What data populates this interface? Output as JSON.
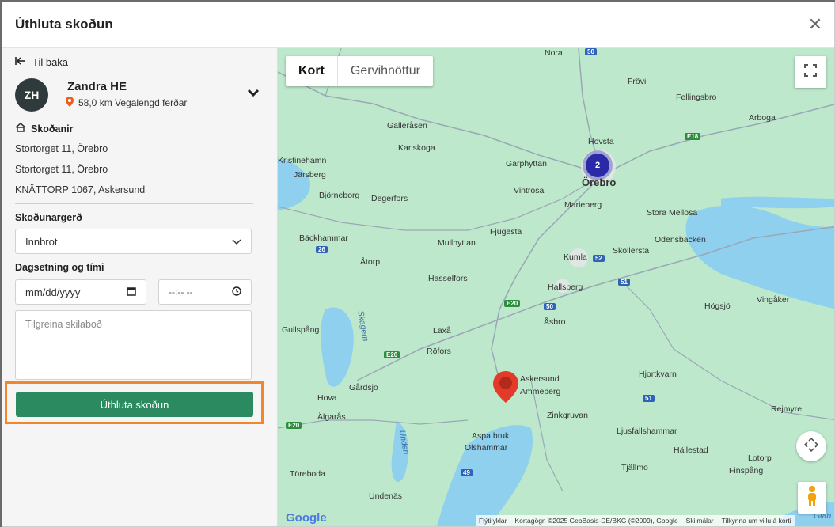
{
  "dialog": {
    "title": "Úthluta skoðun"
  },
  "left": {
    "back_label": "Til baka",
    "person": {
      "initials": "ZH",
      "name": "Zandra HE",
      "distance": "58,0 km Vegalengd ferðar"
    },
    "inspections_heading": "Skoðanir",
    "addresses": [
      "Stortorget 11, Örebro",
      "Stortorget 11, Örebro",
      "KNÄTTORP 1067, Askersund"
    ],
    "type_label": "Skoðunargerð",
    "type_value": "Innbrot",
    "datetime_label": "Dagsetning og tími",
    "date_placeholder": "mm/dd/yyyy",
    "time_placeholder": "--:-- --",
    "message_placeholder": "Tilgreina skilaboð",
    "submit_label": "Úthluta skoðun"
  },
  "map": {
    "tabs": {
      "map": "Kort",
      "satellite": "Gervihnöttur"
    },
    "cluster_count": "2",
    "towns": [
      "Nora",
      "Frövi",
      "Fellingsbro",
      "Arboga",
      "Gälleråsen",
      "Karlskoga",
      "Kristinehamn",
      "Järsberg",
      "Hovsta",
      "Garphyttan",
      "Örebro",
      "Vintrosa",
      "Marieberg",
      "Björneborg",
      "Degerfors",
      "Stora Mellösa",
      "Fjugesta",
      "Bäckhammar",
      "Mullhyttan",
      "Odensbacken",
      "Sköllersta",
      "Kumla",
      "Åtorp",
      "Hasselfors",
      "Hallsberg",
      "Högsjö",
      "Vingåker",
      "Gullspång",
      "Laxå",
      "Åsbro",
      "Röfors",
      "Hjortkvarn",
      "Askersund",
      "Ammeberg",
      "Hova",
      "Gårdsjö",
      "Älgarås",
      "Zinkgruvan",
      "Rejmyre",
      "Ljusfallshammar",
      "Aspa bruk",
      "Olshammar",
      "Hällestad",
      "Lotorp",
      "Töreboda",
      "Tjällmo",
      "Finspång",
      "Undenäs",
      "Skagern",
      "Unden",
      "Glan"
    ],
    "roads": [
      "50",
      "E18",
      "26",
      "52",
      "51",
      "E20",
      "50",
      "E20",
      "51",
      "E20",
      "49"
    ],
    "google": "Google",
    "attribution": [
      "Flýtilyklar",
      "Kortagögn ©2025 GeoBasis-DE/BKG (©2009), Google",
      "Skilmálar",
      "Tilkynna um villu á korti"
    ]
  },
  "colors": {
    "accent": "#2b8a5f",
    "highlight": "#f0872e",
    "pin": "#e23b2a",
    "cluster": "#2a2aa8"
  }
}
